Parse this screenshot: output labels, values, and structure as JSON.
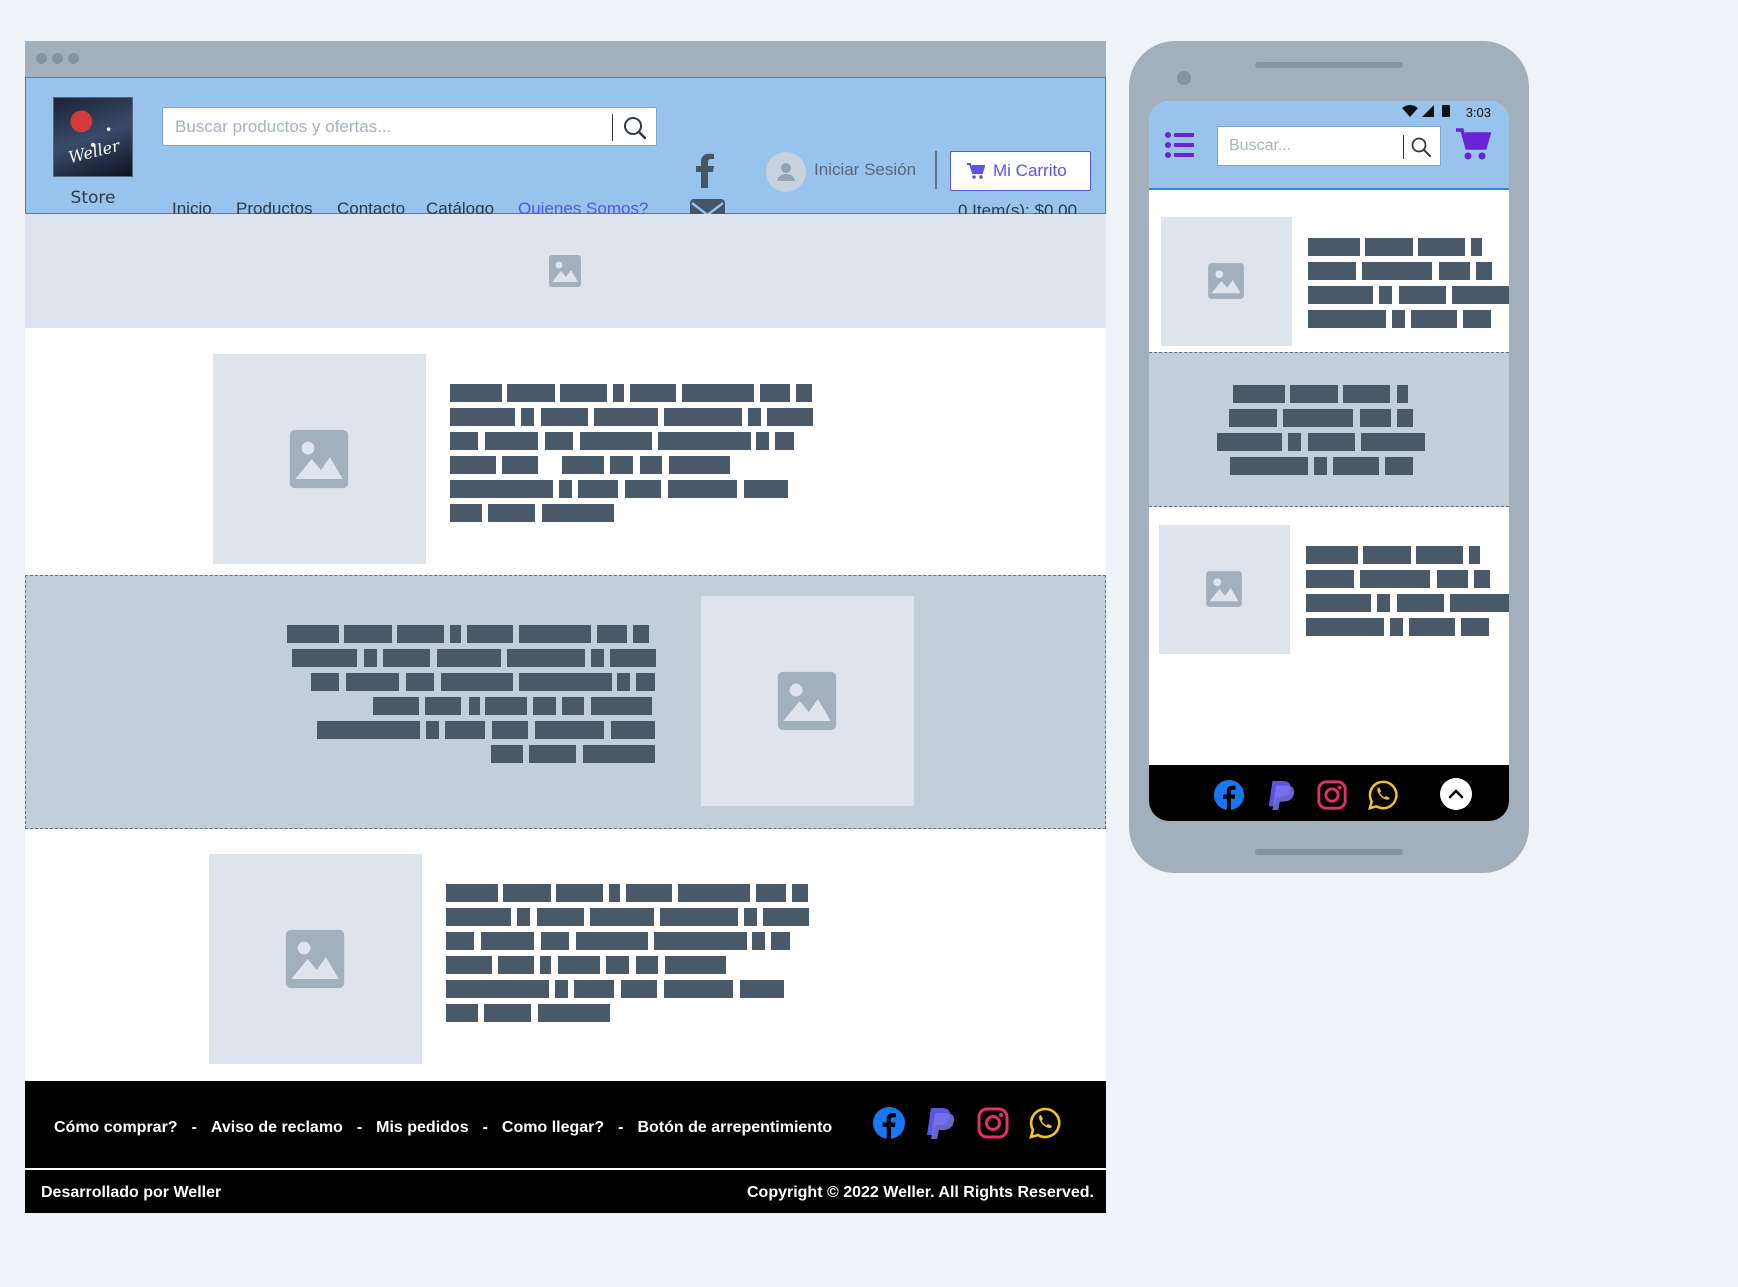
{
  "desktop": {
    "header": {
      "store_label": "Store",
      "logo_signature": "Weller",
      "search_placeholder": "Buscar productos y ofertas...",
      "nav": [
        "Inicio",
        "Productos",
        "Contacto",
        "Catálogo",
        "Quienes Somos?"
      ],
      "active_nav": "Quienes Somos?",
      "login_label": "Iniciar Sesión",
      "cart_label": "Mi Carrito",
      "cart_total": "0 Item(s): $0,00"
    },
    "footer": {
      "links": [
        "Cómo comprar?",
        "Aviso de reclamo",
        "Mis pedidos",
        "Como llegar?",
        "Botón de arrepentimiento"
      ],
      "separator": "-",
      "developed_by": "Desarrollado por Weller",
      "copyright": "Copyright © 2022 Weller.  All Rights Reserved."
    }
  },
  "mobile": {
    "status_time": "3:03",
    "search_placeholder": "Buscar..."
  },
  "icons": {
    "header": [
      "facebook-icon",
      "mail-icon",
      "user-icon",
      "cart-icon",
      "search-icon"
    ],
    "social": [
      "facebook-icon",
      "paypal-icon",
      "instagram-icon",
      "whatsapp-icon"
    ],
    "mobile": [
      "menu-icon",
      "search-icon",
      "cart-icon",
      "scroll-top-icon"
    ]
  },
  "colors": {
    "header_bg": "#97c3ed",
    "accent": "#5a55e0",
    "placeholder_block": "#dde4ed",
    "alt_section": "#c2cfdb",
    "text_bars": "#4a5968",
    "footer_bg": "#000000",
    "facebook": "#1877f2",
    "paypal": "#5a55e0",
    "instagram": "#e1306c",
    "whatsapp": "#f5c518",
    "mobile_icons": "#6a22d6"
  }
}
